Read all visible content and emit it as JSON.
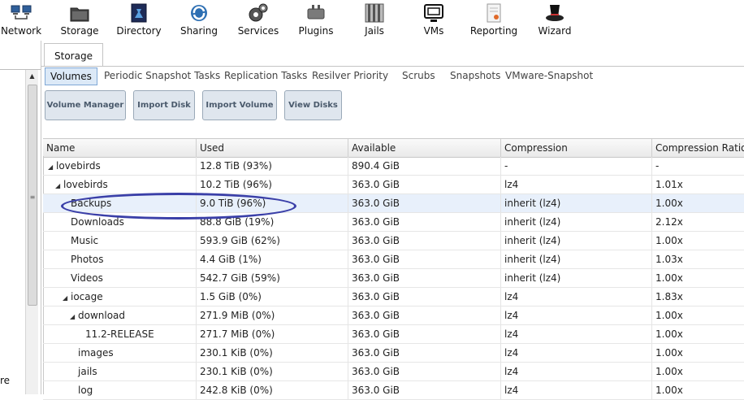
{
  "toolbar": {
    "items": [
      {
        "label": "Network",
        "icon": "network-icon"
      },
      {
        "label": "Storage",
        "icon": "storage-icon"
      },
      {
        "label": "Directory",
        "icon": "directory-icon"
      },
      {
        "label": "Sharing",
        "icon": "sharing-icon"
      },
      {
        "label": "Services",
        "icon": "services-icon"
      },
      {
        "label": "Plugins",
        "icon": "plugins-icon"
      },
      {
        "label": "Jails",
        "icon": "jails-icon"
      },
      {
        "label": "VMs",
        "icon": "vms-icon"
      },
      {
        "label": "Reporting",
        "icon": "reporting-icon"
      },
      {
        "label": "Wizard",
        "icon": "wizard-icon"
      }
    ]
  },
  "left": {
    "fragment_text": "re"
  },
  "main": {
    "tab_label": "Storage",
    "subtabs": [
      "Volumes",
      "Periodic Snapshot Tasks",
      "Replication Tasks",
      "Resilver Priority",
      "Scrubs",
      "Snapshots",
      "VMware-Snapshot"
    ],
    "buttons": [
      "Volume Manager",
      "Import Disk",
      "Import Volume",
      "View Disks"
    ]
  },
  "grid": {
    "columns": [
      "Name",
      "Used",
      "Available",
      "Compression",
      "Compression Ratio"
    ],
    "rows": [
      {
        "name": "lovebirds",
        "used": "12.8 TiB (93%)",
        "available": "890.4 GiB",
        "compression": "-",
        "ratio": "-",
        "indent": 0,
        "expander": "expanded"
      },
      {
        "name": "lovebirds",
        "used": "10.2 TiB (96%)",
        "available": "363.0 GiB",
        "compression": "lz4",
        "ratio": "1.01x",
        "indent": 1,
        "expander": "expanded"
      },
      {
        "name": "Backups",
        "used": "9.0 TiB (96%)",
        "available": "363.0 GiB",
        "compression": "inherit (lz4)",
        "ratio": "1.00x",
        "indent": 2,
        "expander": "none",
        "selected": true
      },
      {
        "name": "Downloads",
        "used": "88.8 GiB (19%)",
        "available": "363.0 GiB",
        "compression": "inherit (lz4)",
        "ratio": "2.12x",
        "indent": 2,
        "expander": "none"
      },
      {
        "name": "Music",
        "used": "593.9 GiB (62%)",
        "available": "363.0 GiB",
        "compression": "inherit (lz4)",
        "ratio": "1.00x",
        "indent": 2,
        "expander": "none"
      },
      {
        "name": "Photos",
        "used": "4.4 GiB (1%)",
        "available": "363.0 GiB",
        "compression": "inherit (lz4)",
        "ratio": "1.03x",
        "indent": 2,
        "expander": "none"
      },
      {
        "name": "Videos",
        "used": "542.7 GiB (59%)",
        "available": "363.0 GiB",
        "compression": "inherit (lz4)",
        "ratio": "1.00x",
        "indent": 2,
        "expander": "none"
      },
      {
        "name": "iocage",
        "used": "1.5 GiB (0%)",
        "available": "363.0 GiB",
        "compression": "lz4",
        "ratio": "1.83x",
        "indent": 2,
        "expander": "expanded"
      },
      {
        "name": "download",
        "used": "271.9 MiB (0%)",
        "available": "363.0 GiB",
        "compression": "lz4",
        "ratio": "1.00x",
        "indent": 3,
        "expander": "expanded"
      },
      {
        "name": "11.2-RELEASE",
        "used": "271.7 MiB (0%)",
        "available": "363.0 GiB",
        "compression": "lz4",
        "ratio": "1.00x",
        "indent": 4,
        "expander": "none"
      },
      {
        "name": "images",
        "used": "230.1 KiB (0%)",
        "available": "363.0 GiB",
        "compression": "lz4",
        "ratio": "1.00x",
        "indent": 3,
        "expander": "none"
      },
      {
        "name": "jails",
        "used": "230.1 KiB (0%)",
        "available": "363.0 GiB",
        "compression": "lz4",
        "ratio": "1.00x",
        "indent": 3,
        "expander": "none"
      },
      {
        "name": "log",
        "used": "242.8 KiB (0%)",
        "available": "363.0 GiB",
        "compression": "lz4",
        "ratio": "1.00x",
        "indent": 3,
        "expander": "none"
      }
    ]
  },
  "colors": {
    "highlight_ellipse": "#3a3fa8",
    "selected_row": "#e8f0fb",
    "active_subtab": "#dce9f7"
  }
}
